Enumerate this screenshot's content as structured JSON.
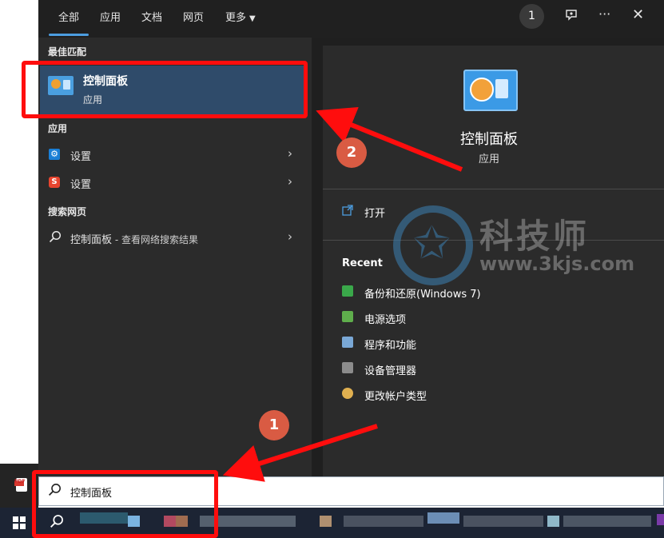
{
  "tabs": [
    {
      "label": "全部",
      "active": true
    },
    {
      "label": "应用"
    },
    {
      "label": "文档"
    },
    {
      "label": "网页"
    },
    {
      "label": "更多"
    }
  ],
  "top_right": {
    "badge": "1",
    "more": "···",
    "close": "✕"
  },
  "best_match": {
    "section": "最佳匹配",
    "title": "控制面板",
    "subtitle": "应用"
  },
  "apps": {
    "section": "应用",
    "items": [
      {
        "label": "设置"
      },
      {
        "label": "设置"
      }
    ]
  },
  "web": {
    "section": "搜索网页",
    "query": "控制面板",
    "suffix": " - 查看网络搜索结果"
  },
  "detail": {
    "title": "控制面板",
    "subtitle": "应用",
    "open_label": "打开",
    "recent_title": "Recent",
    "recent": [
      {
        "label": "备份和还原(Windows 7)"
      },
      {
        "label": "电源选项"
      },
      {
        "label": "程序和功能"
      },
      {
        "label": "设备管理器"
      },
      {
        "label": "更改帐户类型"
      }
    ]
  },
  "watermark": {
    "name": "科技师",
    "url": "www.3kjs.com"
  },
  "annotations": {
    "step1": "1",
    "step2": "2"
  },
  "search_box": {
    "value": "控制面板"
  },
  "pdf_label": "PDF",
  "colors": {
    "accent": "#4c9de0",
    "annotation_red": "#ff0d0d",
    "step_circle": "#d95b43"
  }
}
